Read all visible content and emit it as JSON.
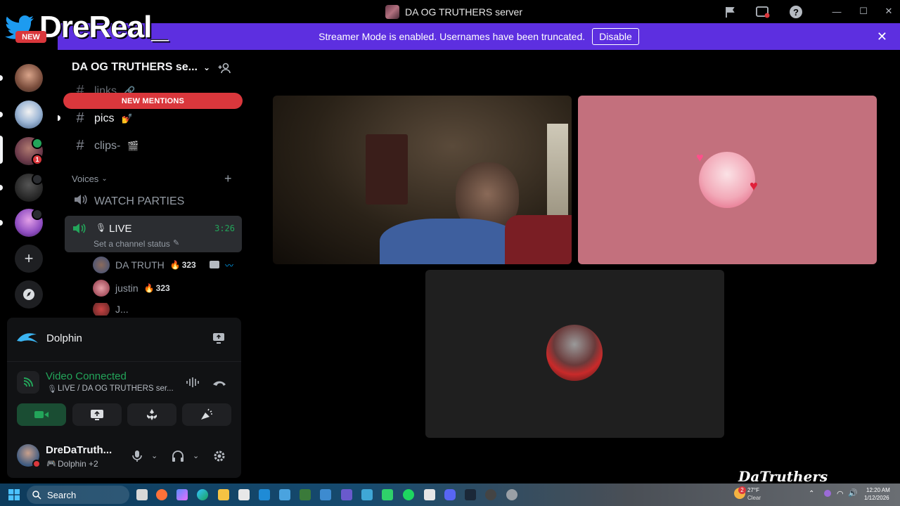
{
  "window": {
    "title": "DA OG TRUTHERS server"
  },
  "overlay": {
    "streamer_name": "DreReal_",
    "new_tag": "NEW"
  },
  "banner": {
    "text": "Streamer Mode is enabled. Usernames have been truncated.",
    "disable_label": "Disable"
  },
  "rail": {
    "unread_count": "1"
  },
  "sidebar": {
    "server_name": "DA OG TRUTHERS se...",
    "new_mentions": "NEW MENTIONS",
    "channels": [
      {
        "name": "links",
        "emoji": "🔗"
      },
      {
        "name": "pics",
        "emoji": "💅"
      },
      {
        "name": "clips-",
        "emoji": "🎬"
      }
    ],
    "category": "Voices",
    "voice_channels": [
      {
        "name": "WATCH PARTIES"
      },
      {
        "name": "LIVE",
        "time": "3:26",
        "status": "Set a channel status"
      }
    ],
    "members": [
      {
        "name": "DA TRUTH",
        "badge": "323"
      },
      {
        "name": "justin",
        "badge": "323"
      },
      {
        "name": "J..."
      }
    ]
  },
  "panel": {
    "activity": "Dolphin",
    "voice_status": "Video Connected",
    "voice_location": "LIVE / DA OG TRUTHERS ser...",
    "user_name": "DreDaTruth...",
    "user_activity": "Dolphin +2"
  },
  "taskbar": {
    "search_label": "Search",
    "weather_temp": "27°F",
    "weather_desc": "Clear",
    "weather_badge": "2",
    "time": "12:20 AM",
    "date": "1/12/2026"
  },
  "watermark": "DaTruthers",
  "colors": {
    "blurple_banner": "#5d2fe0",
    "mention_red": "#da373c",
    "connected_green": "#23a55a",
    "pink_tile": "#c3707d",
    "dark_tile": "#1f1f1f"
  }
}
